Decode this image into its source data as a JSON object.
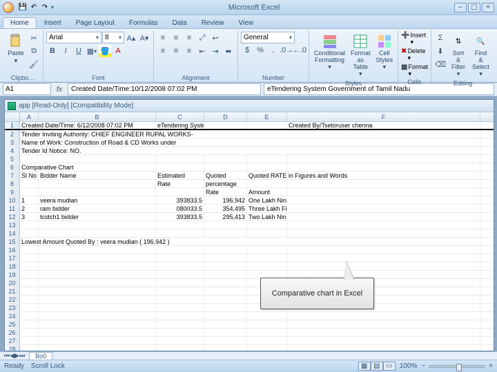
{
  "app": {
    "title": "Microsoft Excel"
  },
  "qa": {
    "save": "💾",
    "undo": "↶",
    "redo": "↷"
  },
  "tabs": [
    "Home",
    "Insert",
    "Page Layout",
    "Formulas",
    "Data",
    "Review",
    "View"
  ],
  "active_tab": "Home",
  "ribbon": {
    "clipboard": {
      "label": "Clipbo…",
      "paste": "Paste"
    },
    "font": {
      "label": "Font",
      "name": "Arial",
      "size": "8",
      "bold": "B",
      "italic": "I",
      "underline": "U"
    },
    "alignment": {
      "label": "Alignment"
    },
    "number": {
      "label": "Number",
      "format": "General"
    },
    "styles": {
      "label": "Styles",
      "cond": "Conditional\nFormatting ▾",
      "table": "Format\nas Table ▾",
      "cell": "Cell\nStyles ▾"
    },
    "cells": {
      "label": "Cells",
      "insert": "Insert ▾",
      "delete": "Delete ▾",
      "format": "Format ▾"
    },
    "editing": {
      "label": "Editing",
      "sort": "Sort &\nFilter ▾",
      "find": "Find &\nSelect ▾"
    }
  },
  "name_box": "A1",
  "formula_text": "Created Date/Time:10/12/2008 07:02 PM",
  "formula_extra": "eTendering System Government of Tamil Nadu",
  "doc_title": "app  [Read-Only]  [Compatibility Mode]",
  "columns": [
    "A",
    "B",
    "C",
    "D",
    "E",
    "F"
  ],
  "rows": [
    {
      "n": 1,
      "A": "Created Date/Time: 6/12/2008 07:02 PM",
      "C": "eTendering System Government of Tamil Nadu",
      "F": "Created By/Tsetoruser chenna",
      "thick": true,
      "spanA": 2
    },
    {
      "n": 2,
      "A": "Tender Inviting Authority: CHIEF ENGINEER RUPAL WORKS-",
      "spanA": 6
    },
    {
      "n": 3,
      "A": "Name of Work: Construction of Road & CD Works under",
      "spanA": 6
    },
    {
      "n": 4,
      "A": "Tender Id Notice: NO.",
      "spanA": 6
    },
    {
      "n": 5
    },
    {
      "n": 6,
      "A": "Comparative Chart",
      "spanA": 2
    },
    {
      "n": 7,
      "A": "Sl No",
      "B": "Bidder Name",
      "C": "Estimated",
      "D": "Quoted",
      "E": "Quoted RATE in Figures and Words",
      "spanE": 2
    },
    {
      "n": 8,
      "C": "Rate",
      "D": "percentage"
    },
    {
      "n": 9,
      "D": "Rate",
      "E": "Amount"
    },
    {
      "n": 10,
      "A": "1",
      "B": "veera mudian",
      "C": "393833.5",
      "D": "196,942",
      "E": "One Lakh Ninty Six Thousand Nine Hundred and Fourty Two",
      "ar": true
    },
    {
      "n": 11,
      "A": "2",
      "B": "ram bidder",
      "C": "080033.5",
      "D": "354,495",
      "E": "Three Lakh Fifty Four Thousand Four Hundred and Ninty Five",
      "ar": true
    },
    {
      "n": 12,
      "A": "3",
      "B": "tcstch1 bidder",
      "C": "393833.5",
      "D": "295,413",
      "E": "Two Lakh Ninty Five Thousand Four Hundred and Thirteen",
      "ar": true
    },
    {
      "n": 13
    },
    {
      "n": 14
    },
    {
      "n": 15,
      "A": "Lowest Amount Quoted By : veera mudian ( 196,942 )",
      "spanA": 6
    },
    {
      "n": 16
    },
    {
      "n": 17
    },
    {
      "n": 18
    },
    {
      "n": 19
    },
    {
      "n": 20
    },
    {
      "n": 21
    },
    {
      "n": 22
    },
    {
      "n": 23
    },
    {
      "n": 24
    },
    {
      "n": 25
    },
    {
      "n": 26
    },
    {
      "n": 27
    },
    {
      "n": 28
    }
  ],
  "callout": "Comparative chart in Excel",
  "status": {
    "ready": "Ready",
    "scroll": "Scroll Lock",
    "zoom": "100%"
  },
  "sheet_tab": "Bo0"
}
